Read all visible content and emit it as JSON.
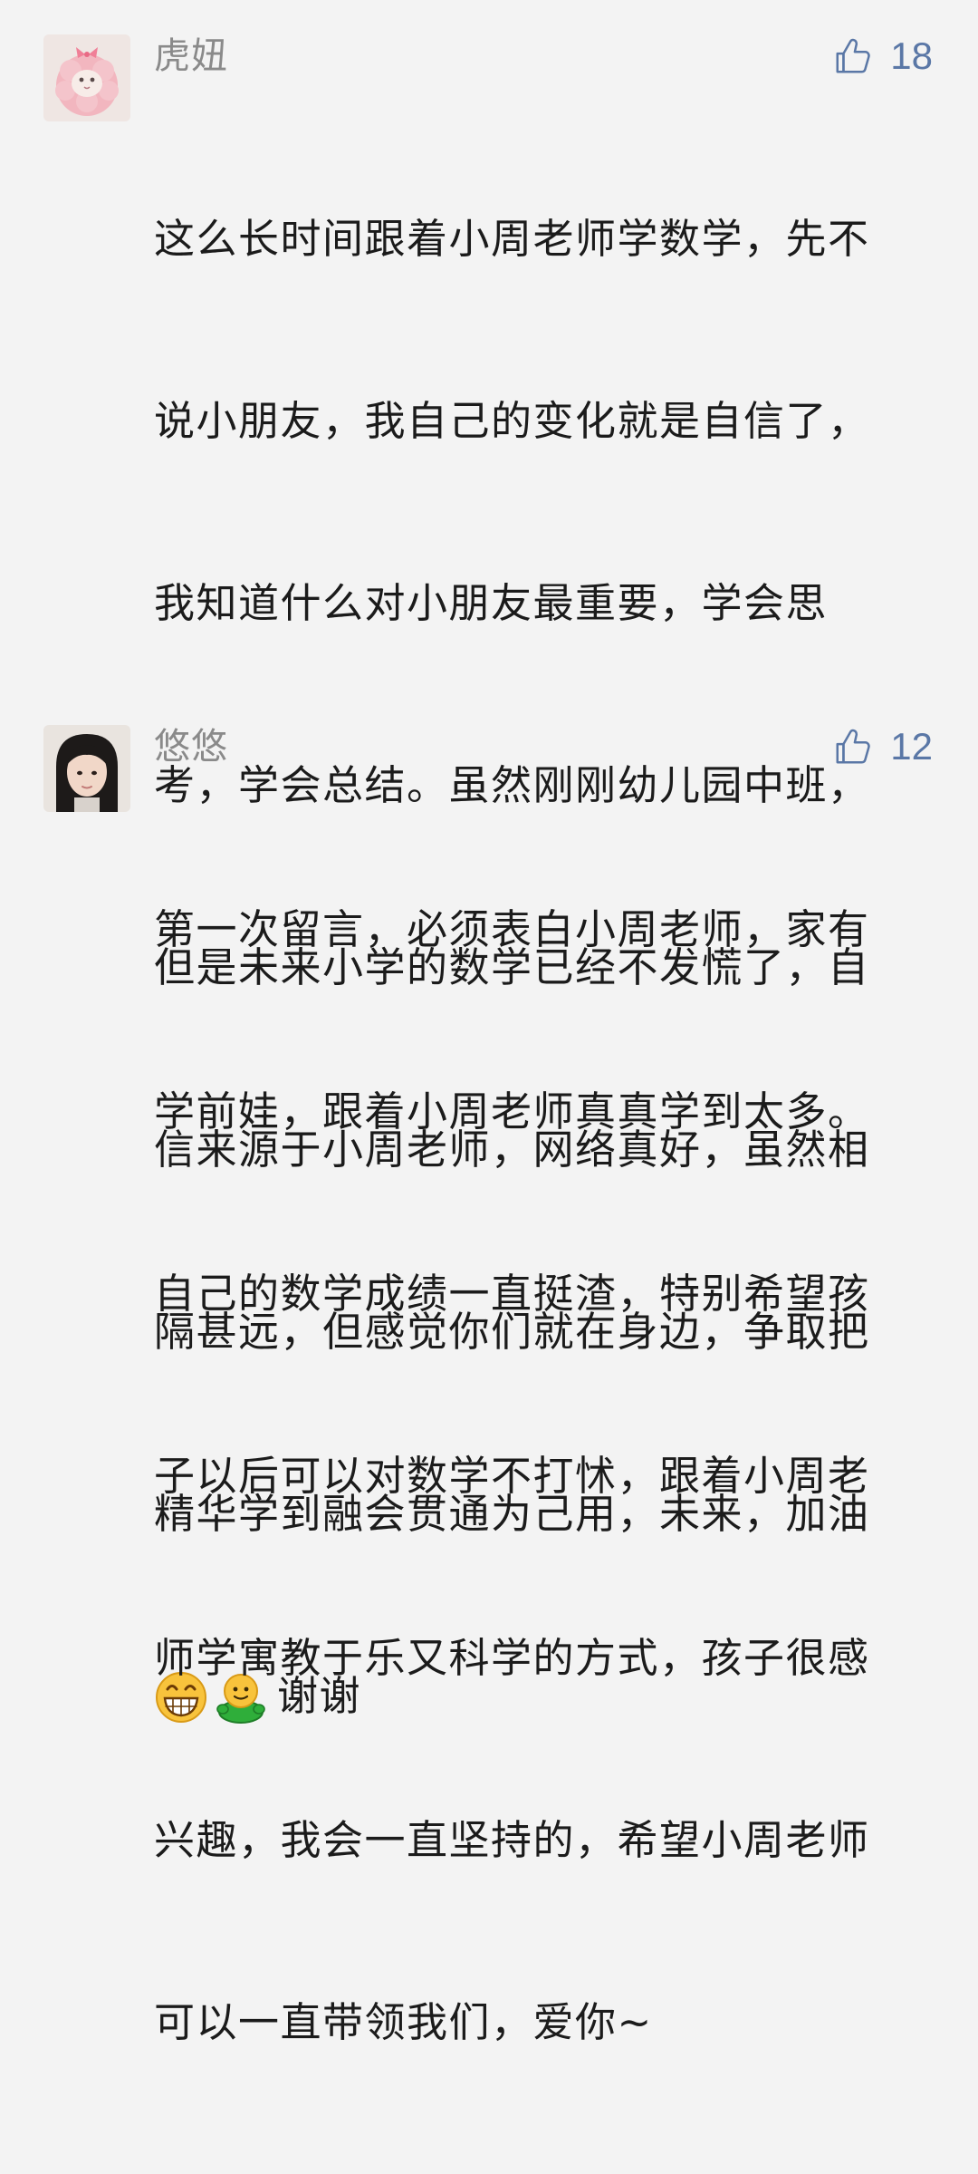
{
  "comments": [
    {
      "nickname": "虎妞",
      "likes": "18",
      "avatar_icon": "pink-cat-avatar",
      "lines": [
        "这么长时间跟着小周老师学数学，先不",
        "说小朋友，我自己的变化就是自信了，",
        "我知道什么对小朋友最重要，学会思",
        "考，学会总结。虽然刚刚幼儿园中班，",
        "但是未来小学的数学已经不发慌了，自",
        "信来源于小周老师，网络真好，虽然相",
        "隔甚远，但感觉你们就在身边，争取把",
        "精华学到融会贯通为己用，未来，加油"
      ],
      "emojis": [
        "grin-emoji",
        "green-frog-emoji"
      ],
      "tail_text": "谢谢"
    },
    {
      "nickname": "悠悠",
      "likes": "12",
      "avatar_icon": "girl-photo-avatar",
      "lines": [
        "第一次留言，必须表白小周老师，家有",
        "学前娃，跟着小周老师真真学到太多。",
        "自己的数学成绩一直挺渣，特别希望孩",
        "子以后可以对数学不打怵，跟着小周老",
        "师学寓教于乐又科学的方式，孩子很感",
        "兴趣，我会一直坚持的，希望小周老师",
        "可以一直带领我们，爱你~"
      ]
    }
  ],
  "colors": {
    "background": "#f3f3f3",
    "nickname": "#8a8a8a",
    "like_accent": "#5a77a6",
    "text": "#1b1b1b"
  }
}
